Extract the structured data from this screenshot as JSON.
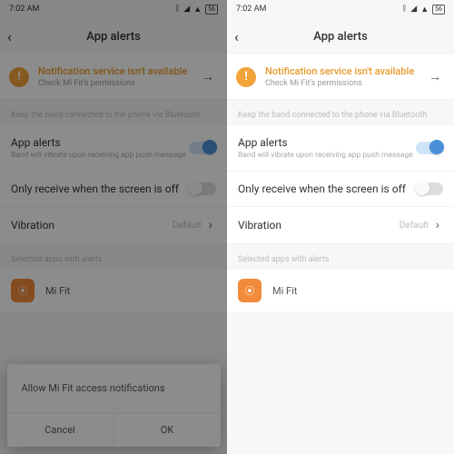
{
  "statusbar": {
    "time": "7:02 AM",
    "battery": "56"
  },
  "header": {
    "title": "App alerts"
  },
  "banner": {
    "title": "Notification service isn't available",
    "subtitle": "Check Mi Fit's permissions"
  },
  "hint1": "Keep the band connected to the phone via Bluetooth",
  "rows": {
    "alerts": {
      "title": "App alerts",
      "sub": "Band will vibrate upon receiving app push message"
    },
    "screen_off": {
      "title": "Only receive when the screen is off"
    },
    "vibration": {
      "title": "Vibration",
      "value": "Default"
    }
  },
  "hint2": "Selected apps with alerts",
  "app": {
    "name": "Mi Fit"
  },
  "dialog": {
    "message": "Allow Mi Fit access notifications",
    "cancel": "Cancel",
    "ok": "OK"
  }
}
